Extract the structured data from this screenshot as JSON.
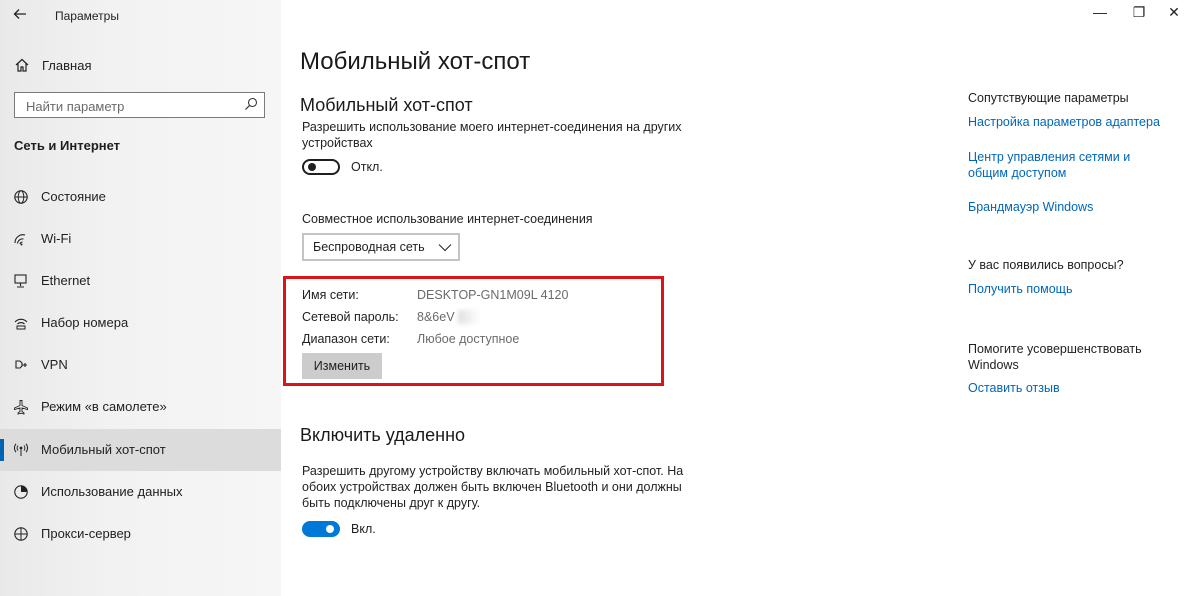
{
  "window": {
    "title": "Параметры",
    "controls": {
      "minimize": "—",
      "maximize": "❐",
      "close": "✕"
    }
  },
  "sidebar": {
    "home_label": "Главная",
    "search": {
      "placeholder": "Найти параметр"
    },
    "section_title": "Сеть и Интернет",
    "items": [
      {
        "label": "Состояние",
        "icon": "globe-icon"
      },
      {
        "label": "Wi-Fi",
        "icon": "wifi-icon"
      },
      {
        "label": "Ethernet",
        "icon": "ethernet-icon"
      },
      {
        "label": "Набор номера",
        "icon": "dialup-icon"
      },
      {
        "label": "VPN",
        "icon": "vpn-icon"
      },
      {
        "label": "Режим «в самолете»",
        "icon": "airplane-icon"
      },
      {
        "label": "Мобильный хот-спот",
        "icon": "hotspot-icon",
        "active": true
      },
      {
        "label": "Использование данных",
        "icon": "data-usage-icon"
      },
      {
        "label": "Прокси-сервер",
        "icon": "proxy-icon"
      }
    ]
  },
  "main": {
    "title": "Мобильный хот-спот",
    "hotspot": {
      "heading": "Мобильный хот-спот",
      "description": "Разрешить использование моего интернет-соединения на других устройствах",
      "toggle_state": "Откл."
    },
    "sharing": {
      "label": "Совместное использование интернет-соединения",
      "selected": "Беспроводная сеть"
    },
    "network": {
      "name_label": "Имя сети:",
      "name_value": "DESKTOP-GN1M09L 4120",
      "password_label": "Сетевой пароль:",
      "password_value": "8&6eV",
      "band_label": "Диапазон сети:",
      "band_value": "Любое доступное",
      "edit_button": "Изменить"
    },
    "remote": {
      "heading": "Включить удаленно",
      "description": "Разрешить другому устройству включать мобильный хот-спот. На обоих устройствах должен быть включен Bluetooth и они должны быть подключены друг к другу.",
      "toggle_state": "Вкл."
    }
  },
  "right": {
    "related_title": "Сопутствующие параметры",
    "link_adapter": "Настройка параметров адаптера",
    "link_network_center": "Центр управления сетями и общим доступом",
    "link_firewall": "Брандмауэр Windows",
    "questions_title": "У вас появились вопросы?",
    "link_help": "Получить помощь",
    "improve_title": "Помогите усовершенствовать Windows",
    "link_feedback": "Оставить отзыв"
  },
  "colors": {
    "accent": "#0078d7",
    "link": "#0067b8",
    "highlight_box": "#d9141b"
  }
}
